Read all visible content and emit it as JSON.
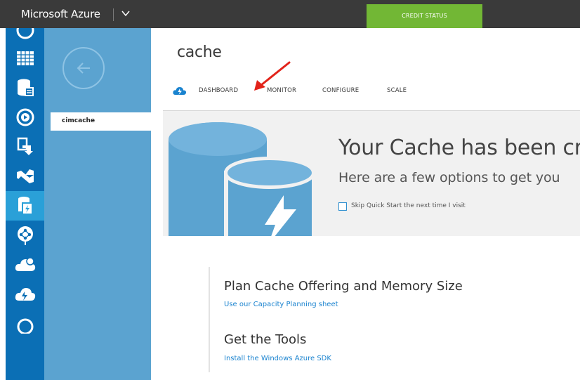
{
  "topbar": {
    "brand": "Microsoft Azure",
    "credit_status": "CREDIT STATUS"
  },
  "rail": {
    "items": [
      {
        "icon": "grid-table-icon"
      },
      {
        "icon": "database-icon"
      },
      {
        "icon": "media-play-icon"
      },
      {
        "icon": "deploy-icon"
      },
      {
        "icon": "visual-studio-icon"
      },
      {
        "icon": "cache-icon",
        "active": true
      },
      {
        "icon": "network-icon"
      },
      {
        "icon": "cloud-service-icon"
      },
      {
        "icon": "cloud-storm-icon"
      },
      {
        "icon": "gear-partial-icon"
      }
    ]
  },
  "pane2": {
    "selected_item": "cimcache"
  },
  "main": {
    "title": "cache",
    "tabs": [
      "DASHBOARD",
      "MONITOR",
      "CONFIGURE",
      "SCALE"
    ],
    "quickstart": {
      "heading": "Your Cache has been cre",
      "subheading": "Here are a few options to get you",
      "skip_label": "Skip Quick Start the next time I visit"
    },
    "sections": [
      {
        "title": "Plan Cache Offering and Memory Size",
        "link": "Use our Capacity Planning sheet"
      },
      {
        "title": "Get the Tools",
        "link": "Install the Windows Azure SDK"
      }
    ]
  },
  "colors": {
    "topbar": "#3a3a3a",
    "credit_green": "#72b735",
    "rail_blue": "#0b6fb5",
    "pane_blue": "#5ba3d0",
    "link_blue": "#1a83cf",
    "arrow_red": "#e2231a"
  }
}
